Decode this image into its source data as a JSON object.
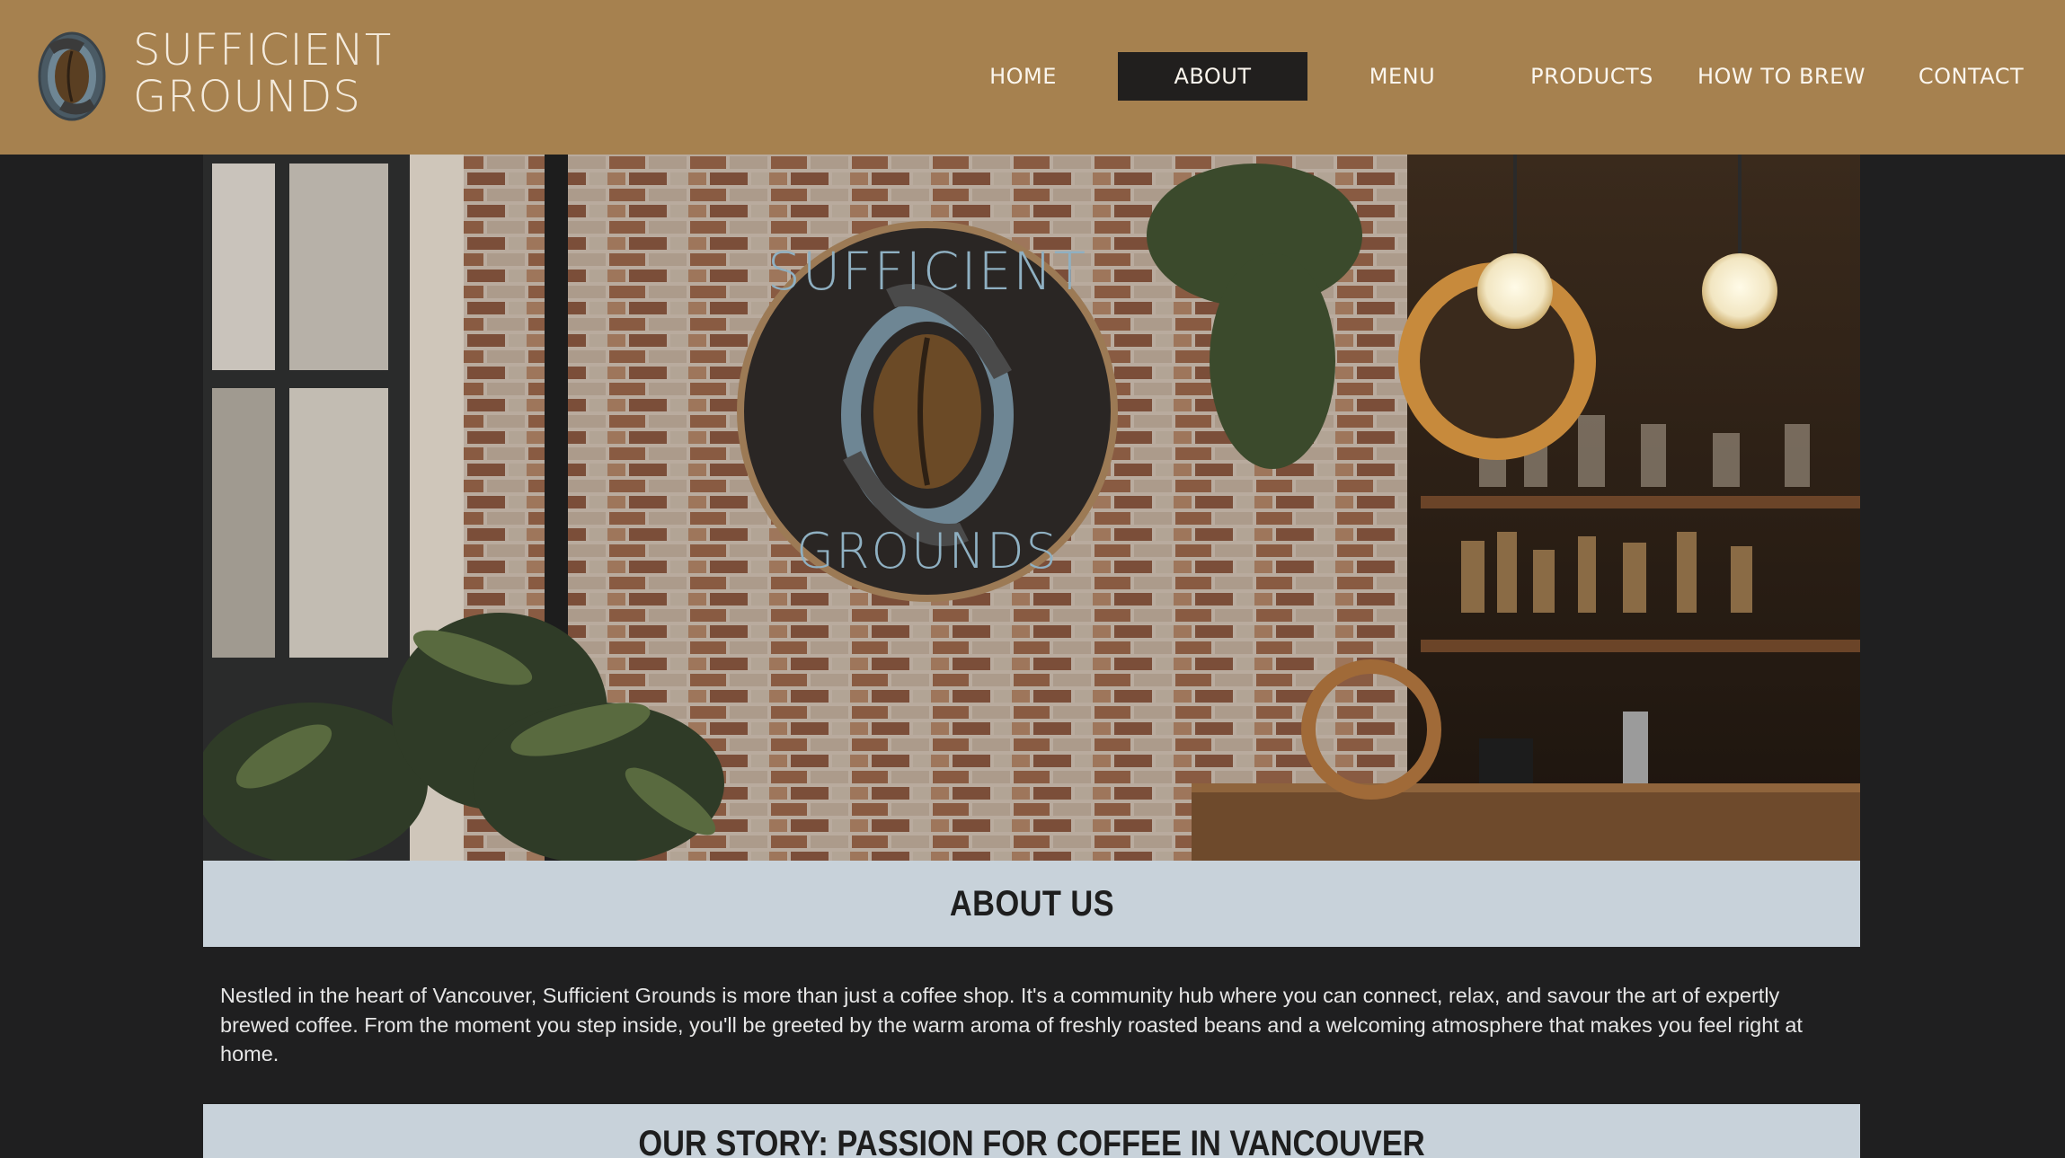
{
  "brand": {
    "line1": "SUFFICIENT",
    "line2": "GROUNDS"
  },
  "nav": {
    "items": [
      {
        "label": "HOME"
      },
      {
        "label": "ABOUT"
      },
      {
        "label": "MENU"
      },
      {
        "label": "PRODUCTS"
      },
      {
        "label": "HOW TO BREW"
      },
      {
        "label": "CONTACT"
      }
    ],
    "active": "ABOUT"
  },
  "hero": {
    "sign_top": "SUFFICIENT",
    "sign_bottom": "GROUNDS"
  },
  "about": {
    "title": "ABOUT US",
    "body": "Nestled in the heart of Vancouver, Sufficient Grounds is more than just a coffee shop. It's a community hub where you can connect, relax, and savour the art of expertly brewed coffee. From the moment you step inside, you'll be greeted by the warm aroma of freshly roasted beans and a welcoming atmosphere that makes you feel right at home."
  },
  "story": {
    "title": "OUR STORY: PASSION FOR COFFEE IN VANCOUVER"
  },
  "colors": {
    "header_bg": "#a6814f",
    "page_bg": "#1f1f20",
    "band_bg": "#c8d2da",
    "nav_active_bg": "#211f1e"
  }
}
